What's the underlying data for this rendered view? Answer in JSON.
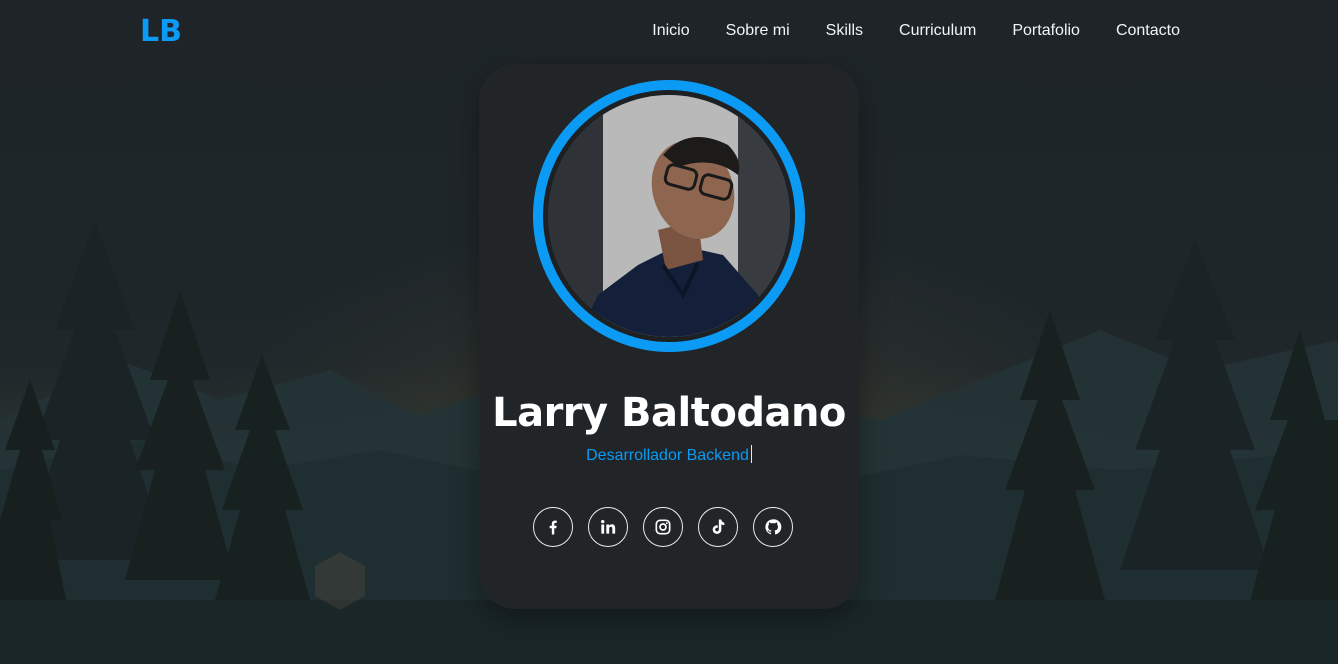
{
  "nav": {
    "logo": "LB",
    "links": [
      "Inicio",
      "Sobre mi",
      "Skills",
      "Curriculum",
      "Portafolio",
      "Contacto"
    ]
  },
  "profile": {
    "name": "Larry Baltodano",
    "role": "Desarrollador Backend"
  },
  "socials": [
    "facebook-icon",
    "linkedin-icon",
    "instagram-icon",
    "tiktok-icon",
    "github-icon"
  ],
  "colors": {
    "accent": "#0b9bf4",
    "card": "#212528",
    "text": "#ffffff"
  }
}
